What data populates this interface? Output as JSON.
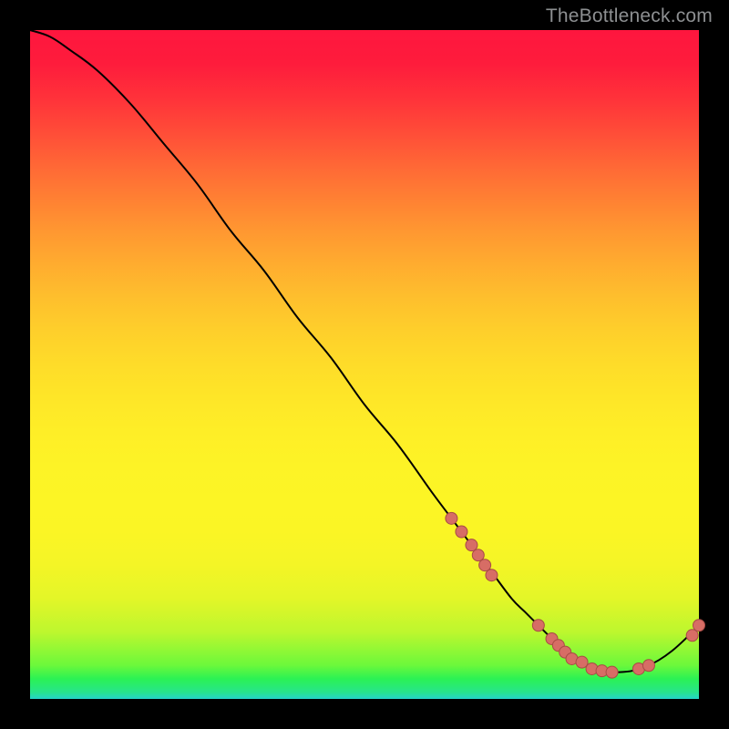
{
  "watermark": "TheBottleneck.com",
  "colors": {
    "page_bg": "#000000",
    "line": "#000000",
    "marker_fill": "#d76d65",
    "marker_stroke": "#a84b45"
  },
  "chart_data": {
    "type": "line",
    "title": "",
    "xlabel": "",
    "ylabel": "",
    "xlim": [
      0,
      100
    ],
    "ylim": [
      0,
      100
    ],
    "grid": false,
    "legend": null,
    "series": [
      {
        "name": "curve",
        "x": [
          0,
          3,
          6,
          10,
          15,
          20,
          25,
          30,
          35,
          40,
          45,
          50,
          55,
          60,
          63,
          66,
          69,
          72,
          74,
          76,
          78,
          80,
          82,
          84,
          86,
          88,
          90,
          92,
          94,
          96,
          98,
          100
        ],
        "y": [
          100,
          99,
          97,
          94,
          89,
          83,
          77,
          70,
          64,
          57,
          51,
          44,
          38,
          31,
          27,
          23,
          19,
          15,
          13,
          11,
          9,
          7,
          5.5,
          4.5,
          4,
          4,
          4.2,
          4.8,
          5.8,
          7.2,
          9,
          11
        ]
      }
    ],
    "markers": [
      {
        "x": 63.0,
        "y": 27.0
      },
      {
        "x": 64.5,
        "y": 25.0
      },
      {
        "x": 66.0,
        "y": 23.0
      },
      {
        "x": 67.0,
        "y": 21.5
      },
      {
        "x": 68.0,
        "y": 20.0
      },
      {
        "x": 69.0,
        "y": 18.5
      },
      {
        "x": 76.0,
        "y": 11.0
      },
      {
        "x": 78.0,
        "y": 9.0
      },
      {
        "x": 79.0,
        "y": 8.0
      },
      {
        "x": 80.0,
        "y": 7.0
      },
      {
        "x": 81.0,
        "y": 6.0
      },
      {
        "x": 82.5,
        "y": 5.5
      },
      {
        "x": 84.0,
        "y": 4.5
      },
      {
        "x": 85.5,
        "y": 4.2
      },
      {
        "x": 87.0,
        "y": 4.0
      },
      {
        "x": 91.0,
        "y": 4.5
      },
      {
        "x": 92.5,
        "y": 5.0
      },
      {
        "x": 99.0,
        "y": 9.5
      },
      {
        "x": 100.0,
        "y": 11.0
      }
    ]
  }
}
